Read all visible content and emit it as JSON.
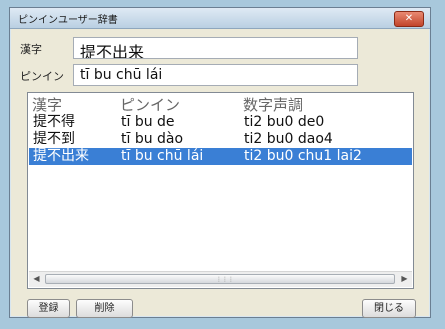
{
  "window": {
    "title": "ピンインユーザー辞書",
    "close_glyph": "✕"
  },
  "form": {
    "kanji_label": "漢字",
    "kanji_value": "提不出来",
    "pinyin_label": "ピンイン",
    "pinyin_value": "tī bu chū lái"
  },
  "list": {
    "headers": [
      "漢字",
      "ピンイン",
      "数字声調"
    ],
    "rows": [
      {
        "kanji": "提不得",
        "pinyin": "tī bu de",
        "tone": "ti2 bu0 de0",
        "selected": false
      },
      {
        "kanji": "提不到",
        "pinyin": "tī bu dào",
        "tone": "ti2 bu0 dao4",
        "selected": false
      },
      {
        "kanji": "提不出来",
        "pinyin": "tī bu chū lái",
        "tone": "ti2 bu0 chu1 lai2",
        "selected": true
      }
    ],
    "scroll_left": "◀",
    "scroll_right": "▶",
    "scroll_grip": "⋮⋮⋮"
  },
  "buttons": {
    "register": "登録",
    "delete": "削除",
    "close": "閉じる"
  },
  "colors": {
    "selection": "#3a7fd5",
    "close_button": "#c2452b"
  }
}
